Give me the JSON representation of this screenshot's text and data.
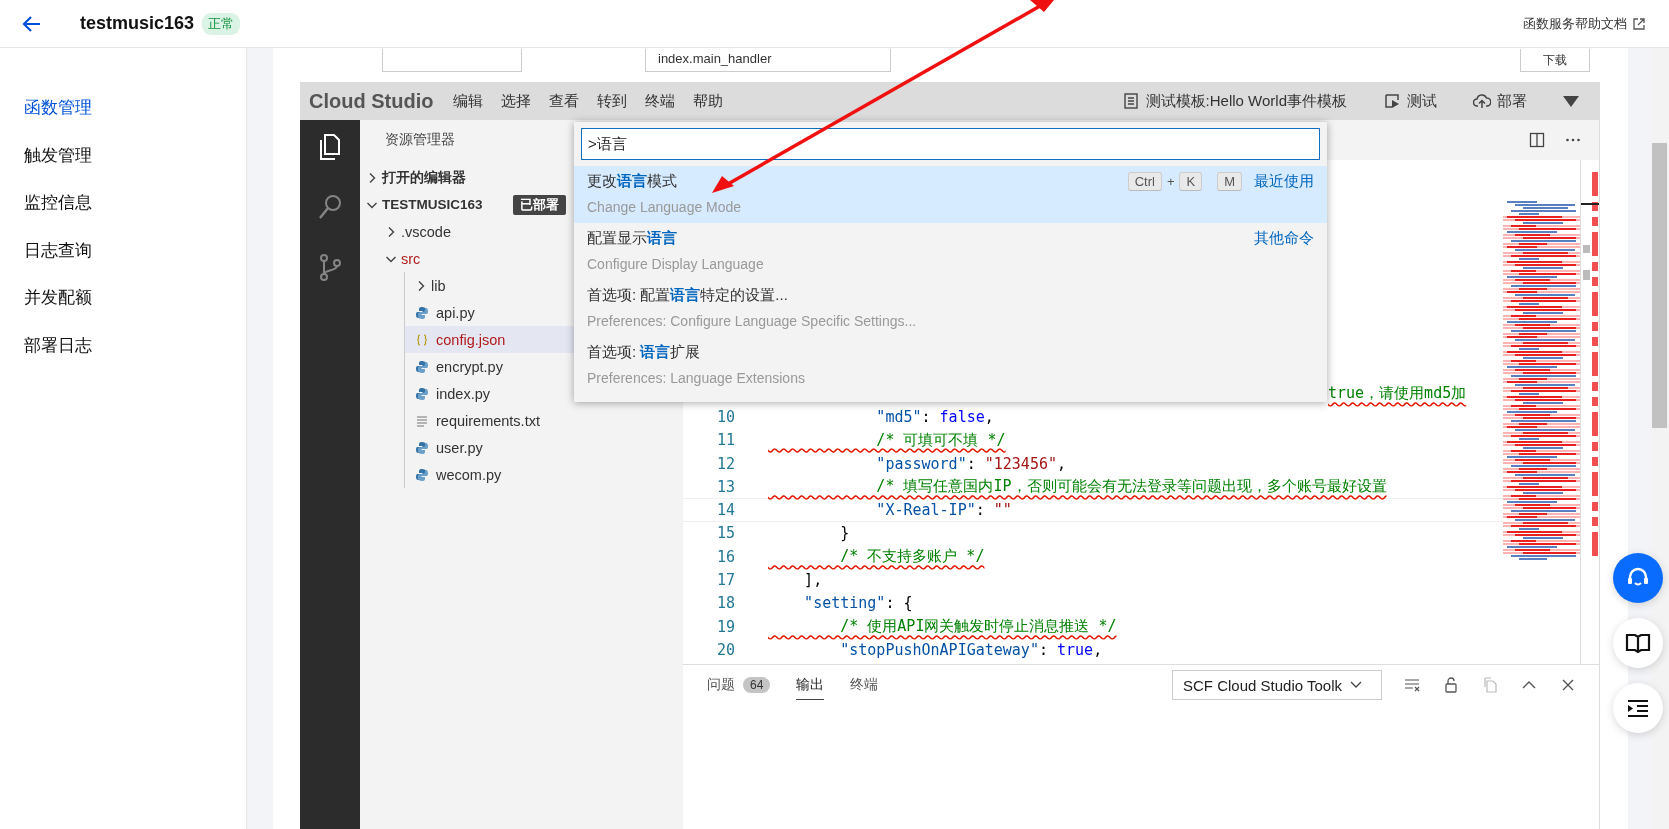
{
  "header": {
    "title": "testmusic163",
    "status": "正常",
    "help_link": "函数服务帮助文档"
  },
  "sidebar": {
    "items": [
      {
        "label": "函数管理",
        "selected": true
      },
      {
        "label": "触发管理",
        "selected": false
      },
      {
        "label": "监控信息",
        "selected": false
      },
      {
        "label": "日志查询",
        "selected": false
      },
      {
        "label": "并发配额",
        "selected": false
      },
      {
        "label": "部署日志",
        "selected": false
      }
    ]
  },
  "form_row": {
    "handler": "index.main_handler",
    "button": "下载"
  },
  "studio": {
    "logo": "Cloud Studio",
    "menu": [
      "编辑",
      "选择",
      "查看",
      "转到",
      "终端",
      "帮助"
    ],
    "actions": [
      {
        "kind": "template",
        "label": "测试模板:Hello World事件模板"
      },
      {
        "kind": "test",
        "label": "测试"
      },
      {
        "kind": "deploy",
        "label": "部署"
      }
    ],
    "activity": [
      {
        "kind": "files",
        "selected": true
      },
      {
        "kind": "search",
        "selected": false
      },
      {
        "kind": "git",
        "selected": false
      }
    ],
    "explorer": {
      "title": "资源管理器",
      "sections": [
        {
          "label": "打开的编辑器",
          "expanded": false
        },
        {
          "label": "TESTMUSIC163",
          "expanded": true,
          "badge": "已部署"
        }
      ],
      "tree": [
        {
          "label": ".vscode",
          "kind": "folder",
          "expanded": false,
          "selected": false,
          "error": false
        },
        {
          "label": "src",
          "kind": "folder",
          "expanded": true,
          "selected": false,
          "error": true,
          "children": [
            {
              "label": "lib",
              "kind": "folder",
              "expanded": false,
              "selected": false,
              "error": false
            },
            {
              "label": "api.py",
              "kind": "python",
              "selected": false,
              "error": false
            },
            {
              "label": "config.json",
              "kind": "json",
              "selected": true,
              "error": true
            },
            {
              "label": "encrypt.py",
              "kind": "python",
              "selected": false,
              "error": false
            },
            {
              "label": "index.py",
              "kind": "python",
              "selected": false,
              "error": false
            },
            {
              "label": "requirements.txt",
              "kind": "text",
              "selected": false,
              "error": false
            },
            {
              "label": "user.py",
              "kind": "python",
              "selected": false,
              "error": false
            },
            {
              "label": "wecom.py",
              "kind": "python",
              "selected": false,
              "error": false
            }
          ]
        }
      ]
    },
    "palette": {
      "value": ">语言",
      "items": [
        {
          "title": "更改**语言**模式",
          "subtitle": "Change Language Mode",
          "keys": [
            {
              "kind": "key",
              "text": "Ctrl"
            },
            {
              "kind": "plus",
              "text": "+"
            },
            {
              "kind": "key",
              "text": "K"
            },
            {
              "kind": "key",
              "text": "M"
            }
          ],
          "hint": "最近使用",
          "selected": true
        },
        {
          "title": "配置显示**语言**",
          "subtitle": "Configure Display Language",
          "hint": "其他命令",
          "selected": false
        },
        {
          "title": "首选项: 配置**语言**特定的设置...",
          "subtitle": "Preferences: Configure Language Specific Settings...",
          "selected": false
        },
        {
          "title": "首选项: **语言**扩展",
          "subtitle": "Preferences: Language Extensions",
          "selected": false
        }
      ]
    },
    "code": [
      {
        "kind": "fragment",
        "tokens": [
          {
            "kind": "comment",
            "text": "true，请使用md5加",
            "error": true
          }
        ]
      },
      {
        "num": "10",
        "tokens": [
          {
            "kind": "key",
            "text": "            \"md5\""
          },
          {
            "kind": "punct",
            "text": ": "
          },
          {
            "kind": "keyword",
            "text": "false"
          },
          {
            "kind": "punct",
            "text": ","
          }
        ]
      },
      {
        "num": "11",
        "tokens": [
          {
            "kind": "comment",
            "text": "            /* 可填可不填 */",
            "error": true
          }
        ]
      },
      {
        "num": "12",
        "tokens": [
          {
            "kind": "key",
            "text": "            \"password\""
          },
          {
            "kind": "punct",
            "text": ": "
          },
          {
            "kind": "string",
            "text": "\"123456\""
          },
          {
            "kind": "punct",
            "text": ","
          }
        ]
      },
      {
        "num": "13",
        "tokens": [
          {
            "kind": "comment",
            "text": "            /* 填写任意国内IP，否则可能会有无法登录等问题出现，多个账号最好设置",
            "error": true
          }
        ]
      },
      {
        "num": "14",
        "current": true,
        "tokens": [
          {
            "kind": "key",
            "text": "            \"X-Real-IP\""
          },
          {
            "kind": "punct",
            "text": ": "
          },
          {
            "kind": "string",
            "text": "\"\""
          }
        ]
      },
      {
        "num": "15",
        "tokens": [
          {
            "kind": "punct",
            "text": "        }"
          }
        ]
      },
      {
        "num": "16",
        "tokens": [
          {
            "kind": "comment",
            "text": "        /* 不支持多账户 */",
            "error": true
          }
        ]
      },
      {
        "num": "17",
        "tokens": [
          {
            "kind": "punct",
            "text": "    ],"
          }
        ]
      },
      {
        "num": "18",
        "tokens": [
          {
            "kind": "key",
            "text": "    \"setting\""
          },
          {
            "kind": "punct",
            "text": ": {"
          }
        ]
      },
      {
        "num": "19",
        "tokens": [
          {
            "kind": "comment",
            "text": "        /* 使用API网关触发时停止消息推送 */",
            "error": true
          }
        ]
      },
      {
        "num": "20",
        "tokens": [
          {
            "kind": "key",
            "text": "        \"stopPushOnAPIGateway\""
          },
          {
            "kind": "punct",
            "text": ": "
          },
          {
            "kind": "keyword",
            "text": "true"
          },
          {
            "kind": "punct",
            "text": ","
          }
        ]
      }
    ],
    "panel": {
      "tabs": [
        {
          "label": "问题",
          "badge": "64",
          "selected": false
        },
        {
          "label": "输出",
          "selected": true
        },
        {
          "label": "终端",
          "selected": false
        }
      ],
      "channel": "SCF Cloud Studio Toolk",
      "tools": [
        {
          "kind": "clear",
          "disabled": false
        },
        {
          "kind": "lock",
          "disabled": false
        },
        {
          "kind": "copy",
          "disabled": true
        },
        {
          "kind": "up",
          "disabled": false
        },
        {
          "kind": "close",
          "disabled": false
        }
      ]
    }
  },
  "float_buttons": [
    {
      "kind": "support"
    },
    {
      "kind": "book"
    },
    {
      "kind": "outline"
    }
  ]
}
